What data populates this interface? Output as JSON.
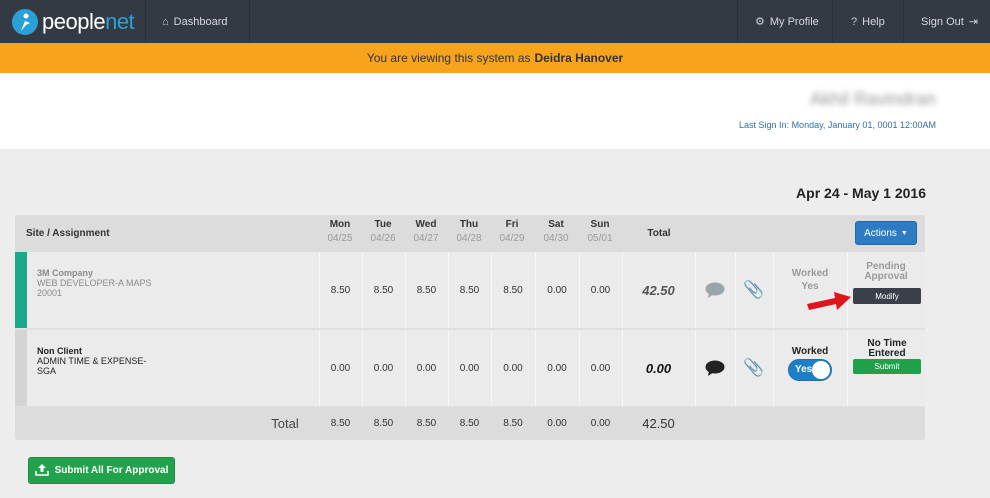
{
  "nav": {
    "logo_text_a": "people",
    "logo_text_b": "net",
    "dashboard": "Dashboard",
    "my_profile": "My Profile",
    "help": "Help",
    "sign_out": "Sign Out"
  },
  "banner": {
    "prefix": "You are viewing this system as",
    "user": "Deidra Hanover"
  },
  "header": {
    "user_name": "Akhil Ravindran",
    "last_sign_in": "Last Sign In: Monday, January 01, 0001 12:00AM"
  },
  "period": "Apr 24 - May 1 2016",
  "grid": {
    "site_header": "Site / Assignment",
    "total_header": "Total",
    "actions_label": "Actions",
    "days": [
      {
        "name": "Mon",
        "date": "04/25"
      },
      {
        "name": "Tue",
        "date": "04/26"
      },
      {
        "name": "Wed",
        "date": "04/27"
      },
      {
        "name": "Thu",
        "date": "04/28"
      },
      {
        "name": "Fri",
        "date": "04/29"
      },
      {
        "name": "Sat",
        "date": "04/30"
      },
      {
        "name": "Sun",
        "date": "05/01"
      }
    ],
    "rows": [
      {
        "company": "3M Company",
        "assignment": "WEB DEVELOPER-A MAPS",
        "code": "20001",
        "hours": [
          "8.50",
          "8.50",
          "8.50",
          "8.50",
          "8.50",
          "0.00",
          "0.00"
        ],
        "total": "42.50",
        "worked_label": "Worked",
        "worked_value": "Yes",
        "status": "Pending Approval",
        "action": "Modify",
        "stripe_color": "#1aa98a"
      },
      {
        "company": "Non Client",
        "assignment": "ADMIN TIME & EXPENSE-",
        "code": "SGA",
        "hours": [
          "0.00",
          "0.00",
          "0.00",
          "0.00",
          "0.00",
          "0.00",
          "0.00"
        ],
        "total": "0.00",
        "worked_label": "Worked",
        "worked_value": "Yes",
        "status": "No Time Entered",
        "action": "Submit",
        "stripe_color": "#d4d4d4"
      }
    ],
    "totals_label": "Total",
    "totals": [
      "8.50",
      "8.50",
      "8.50",
      "8.50",
      "8.50",
      "0.00",
      "0.00"
    ],
    "grand_total": "42.50"
  },
  "submit_all": "Submit All For Approval",
  "icons": {
    "dashboard": "home-icon",
    "profile": "gear-icon",
    "help": "question-icon",
    "signout": "sign-out-icon",
    "comment": "comment-icon",
    "attach": "paperclip-icon",
    "upload": "upload-icon",
    "arrow": "red-arrow-icon"
  }
}
